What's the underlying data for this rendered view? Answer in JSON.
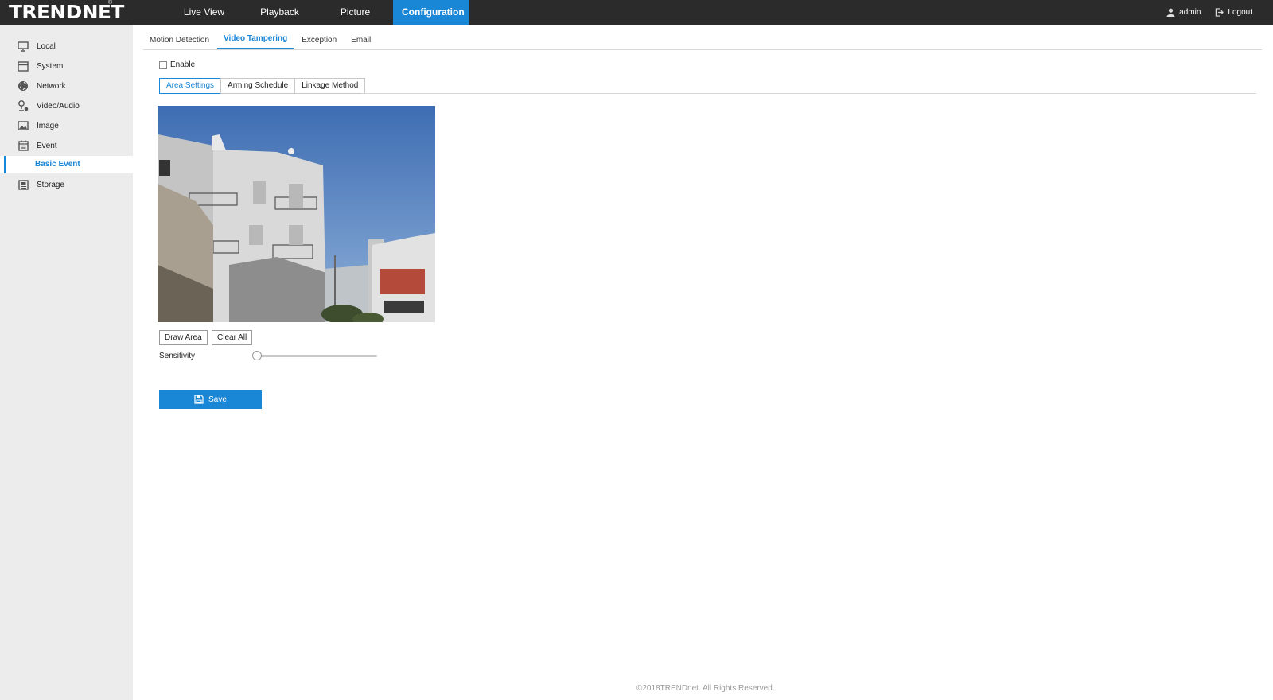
{
  "brand": {
    "logo_text": "TRENDNET",
    "registered_mark": "®",
    "accent_color": "#1a86d6"
  },
  "nav": {
    "items": [
      {
        "label": "Live View"
      },
      {
        "label": "Playback"
      },
      {
        "label": "Picture"
      },
      {
        "label": "Configuration",
        "active": true
      }
    ]
  },
  "user": {
    "name": "admin",
    "logout_label": "Logout"
  },
  "sidebar": {
    "items": [
      {
        "label": "Local",
        "icon": "monitor-icon"
      },
      {
        "label": "System",
        "icon": "system-window-icon"
      },
      {
        "label": "Network",
        "icon": "globe-icon"
      },
      {
        "label": "Video/Audio",
        "icon": "microphone-icon"
      },
      {
        "label": "Image",
        "icon": "image-icon"
      },
      {
        "label": "Event",
        "icon": "calendar-icon"
      },
      {
        "label": "Storage",
        "icon": "storage-icon"
      }
    ],
    "sub_item": "Basic Event"
  },
  "tabs": [
    {
      "label": "Motion Detection"
    },
    {
      "label": "Video Tampering",
      "active": true
    },
    {
      "label": "Exception"
    },
    {
      "label": "Email"
    }
  ],
  "enable": {
    "label": "Enable",
    "checked": false
  },
  "subtabs": [
    {
      "label": "Area Settings",
      "active": true
    },
    {
      "label": "Arming Schedule"
    },
    {
      "label": "Linkage Method"
    }
  ],
  "area": {
    "draw_label": "Draw Area",
    "clear_label": "Clear All",
    "sensitivity_label": "Sensitivity",
    "sensitivity_value": 0
  },
  "save_label": "Save",
  "footer": "©2018TRENDnet. All Rights Reserved."
}
